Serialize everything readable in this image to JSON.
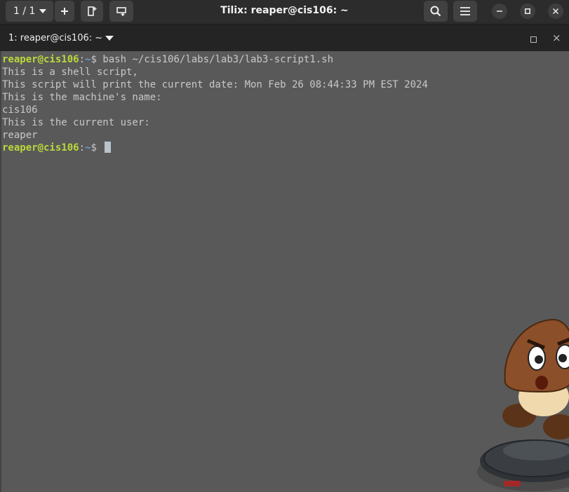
{
  "window": {
    "title": "Tilix: reaper@cis106: ~",
    "session_selector": "1 / 1"
  },
  "tab": {
    "title": "1: reaper@cis106: ~"
  },
  "terminal": {
    "prompt_user": "reaper@cis106",
    "prompt_sep": ":",
    "prompt_path": "~",
    "prompt_symbol": "$ ",
    "command": "bash ~/cis106/labs/lab3/lab3-script1.sh",
    "output": [
      "This is a shell script,",
      "This script will print the current date: Mon Feb 26 08:44:33 PM EST 2024",
      "This is the machine's name:",
      "cis106",
      "This is the current user:",
      "reaper"
    ]
  },
  "icons": {
    "add": "plus-icon",
    "split_horizontal": "split-horizontal-icon",
    "split_vertical": "split-vertical-icon",
    "search": "search-icon",
    "menu": "hamburger-menu-icon",
    "minimize": "minimize-icon",
    "maximize": "maximize-icon",
    "close": "close-icon"
  },
  "colors": {
    "prompt_user": "#b8d93a",
    "prompt_path": "#6ea0d6",
    "terminal_bg": "#595959",
    "terminal_fg": "#c8c8c8"
  }
}
